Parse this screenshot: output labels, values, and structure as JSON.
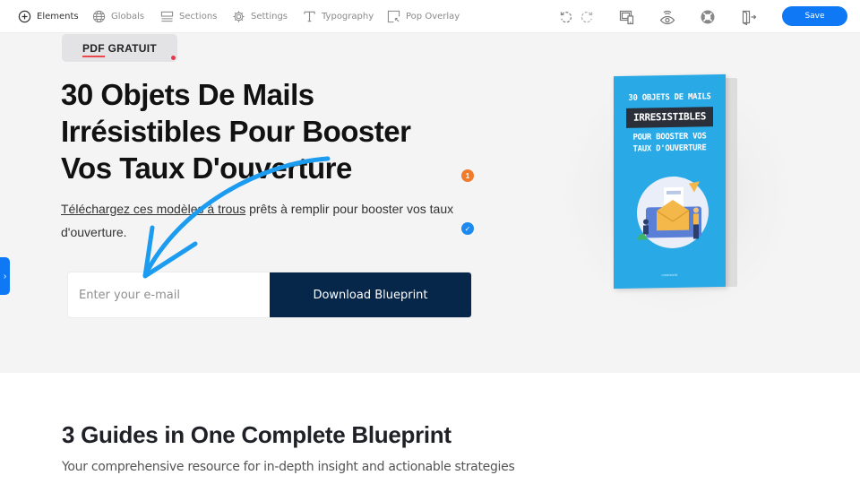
{
  "toolbar": {
    "nav": [
      {
        "label": "Elements",
        "icon": "plus-circle-icon",
        "active": true
      },
      {
        "label": "Globals",
        "icon": "globe-icon",
        "active": false
      },
      {
        "label": "Sections",
        "icon": "sections-icon",
        "active": false
      },
      {
        "label": "Settings",
        "icon": "gear-icon",
        "active": false
      },
      {
        "label": "Typography",
        "icon": "typography-icon",
        "active": false
      },
      {
        "label": "Pop Overlay",
        "icon": "popup-icon",
        "active": false
      }
    ],
    "tools": [
      {
        "name": "undo",
        "icon": "undo-icon"
      },
      {
        "name": "redo",
        "icon": "redo-icon"
      },
      {
        "name": "responsive-preview",
        "icon": "devices-icon"
      },
      {
        "name": "preview",
        "icon": "eye-icon"
      },
      {
        "name": "help",
        "icon": "lifebuoy-icon"
      },
      {
        "name": "exit",
        "icon": "exit-icon"
      }
    ],
    "save_label": "Save",
    "accent_color": "#0f78f5"
  },
  "hero": {
    "badge": {
      "pdf": "PDF",
      "rest": " GRATUIT"
    },
    "title_lines": [
      "30 Objets De Mails",
      "Irrésistibles Pour Booster",
      "Vos Taux D'ouverture"
    ],
    "description": {
      "link_text": "Téléchargez ces modèles à trous",
      "rest": " prêts à remplir pour booster vos taux d'ouverture."
    },
    "notification_count": "1",
    "form": {
      "email_placeholder": "Enter your e-mail",
      "email_value": "",
      "button_label": "Download Blueprint",
      "button_color": "#06264a"
    },
    "book": {
      "line1": "30 OBJETS DE MAILS",
      "line2": "IRRESISTIBLES",
      "line3": "POUR BOOSTER VOS",
      "line4": "TAUX D'OUVERTURE",
      "footer": "COMPAGNIE",
      "cover_color": "#29a9e6"
    }
  },
  "section2": {
    "title": "3 Guides in One Complete Blueprint",
    "subtitle": "Your comprehensive resource for in-depth insight and actionable strategies"
  }
}
